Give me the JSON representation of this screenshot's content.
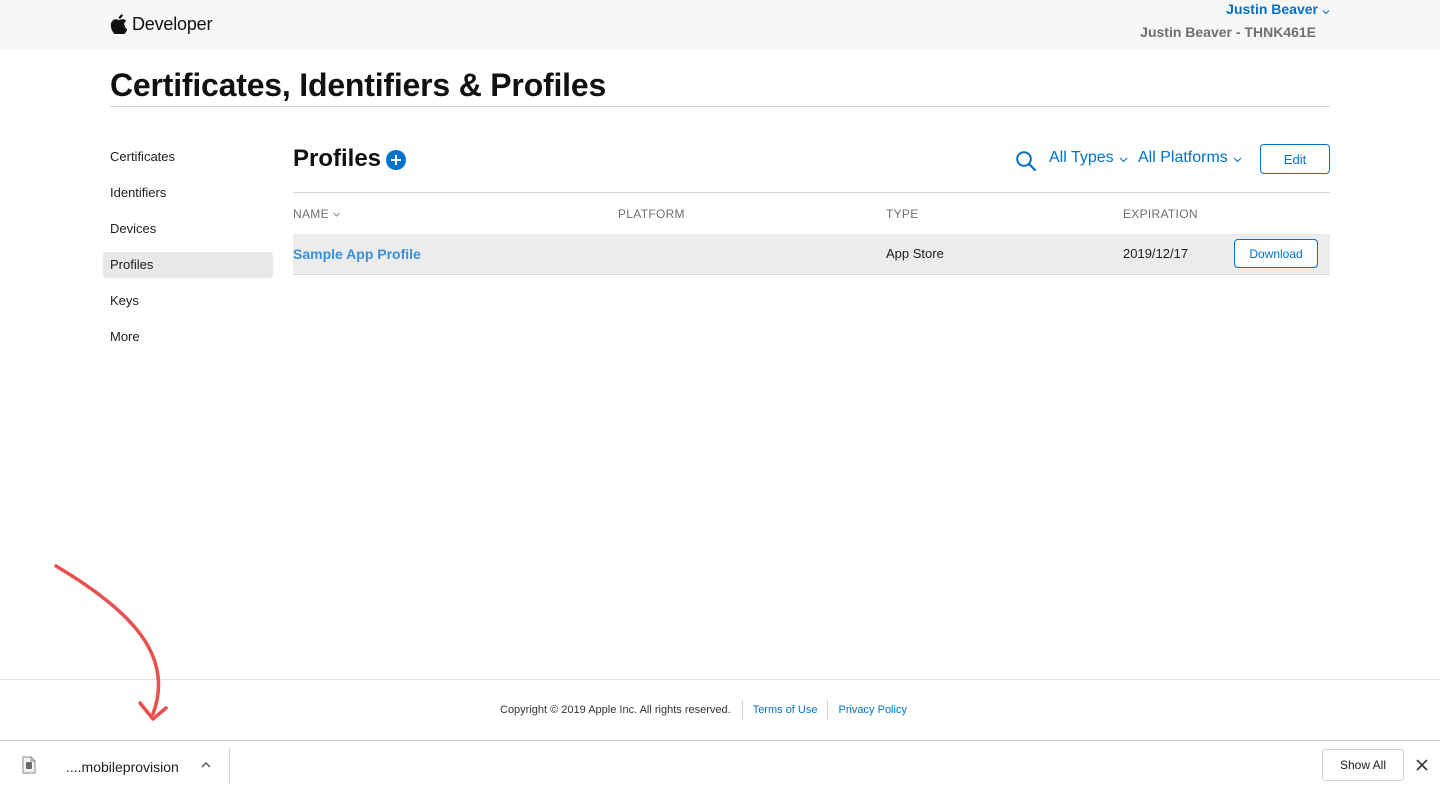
{
  "header": {
    "brand": "Developer",
    "user_name": "Justin Beaver",
    "team": "Justin Beaver - THNK461E"
  },
  "page": {
    "title": "Certificates, Identifiers & Profiles"
  },
  "sidebar": {
    "items": [
      {
        "label": "Certificates"
      },
      {
        "label": "Identifiers"
      },
      {
        "label": "Devices"
      },
      {
        "label": "Profiles",
        "active": true
      },
      {
        "label": "Keys"
      },
      {
        "label": "More"
      }
    ]
  },
  "main": {
    "title": "Profiles",
    "filters": {
      "types": "All Types",
      "platforms": "All Platforms"
    },
    "edit_label": "Edit"
  },
  "table": {
    "columns": [
      "NAME",
      "PLATFORM",
      "TYPE",
      "EXPIRATION"
    ],
    "rows": [
      {
        "name": "Sample App Profile",
        "platform": "",
        "type": "App Store",
        "expiration": "2019/12/17",
        "action": "Download"
      }
    ]
  },
  "footer": {
    "copyright": "Copyright © 2019 Apple Inc. All rights reserved.",
    "terms": "Terms of Use",
    "privacy": "Privacy Policy"
  },
  "download_shelf": {
    "file_name": "....mobileprovision",
    "show_all": "Show All"
  },
  "colors": {
    "accent": "#0070c9",
    "link": "#3b8fd8",
    "annotation": "#e8504f",
    "row_highlight": "#ececec"
  },
  "icons": [
    "apple-logo-icon",
    "chevron-down-icon",
    "add-icon",
    "search-icon",
    "sort-caret-icon",
    "file-icon",
    "chevron-up-icon",
    "close-icon",
    "annotation-arrow"
  ]
}
